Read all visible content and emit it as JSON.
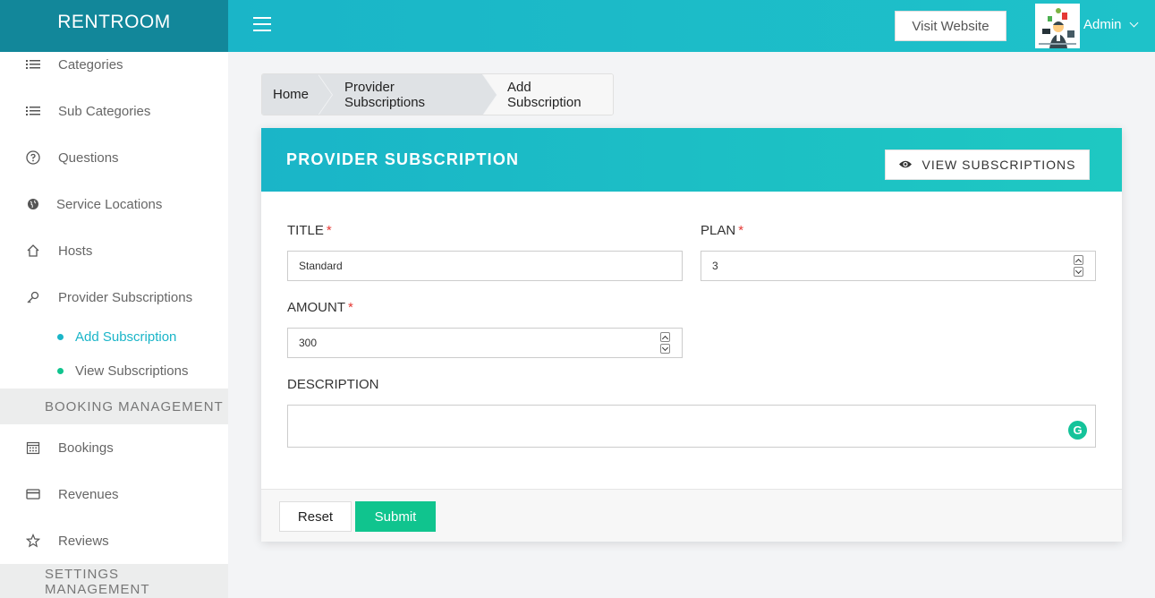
{
  "brand": "RENTROOM",
  "topbar": {
    "visit_website": "Visit Website",
    "user_name": "Admin"
  },
  "sidebar": {
    "items": [
      {
        "label": "Categories",
        "icon": "list-icon"
      },
      {
        "label": "Sub Categories",
        "icon": "list-icon"
      },
      {
        "label": "Questions",
        "icon": "question-circle-icon"
      },
      {
        "label": "Service Locations",
        "icon": "globe-icon"
      },
      {
        "label": "Hosts",
        "icon": "home-icon"
      },
      {
        "label": "Provider Subscriptions",
        "icon": "key-icon"
      }
    ],
    "sub_items": [
      {
        "label": "Add Subscription",
        "active": true
      },
      {
        "label": "View Subscriptions",
        "active": false
      }
    ],
    "section_booking": "BOOKING MANAGEMENT",
    "booking_items": [
      {
        "label": "Bookings",
        "icon": "calendar-icon"
      },
      {
        "label": "Revenues",
        "icon": "credit-card-icon"
      },
      {
        "label": "Reviews",
        "icon": "star-icon"
      }
    ],
    "section_settings": "SETTINGS MANAGEMENT"
  },
  "breadcrumb": [
    "Home",
    "Provider Subscriptions",
    "Add Subscription"
  ],
  "card": {
    "title": "PROVIDER SUBSCRIPTION",
    "view_button": "VIEW SUBSCRIPTIONS"
  },
  "form": {
    "title_label": "TITLE",
    "title_value": "Standard",
    "plan_label": "PLAN",
    "plan_value": "3",
    "amount_label": "AMOUNT",
    "amount_value": "300",
    "description_label": "DESCRIPTION",
    "description_value": "",
    "required_mark": "*",
    "grammarly_glyph": "G"
  },
  "footer": {
    "reset": "Reset",
    "submit": "Submit"
  },
  "colors": {
    "accent": "#1ab5c8",
    "brand_dark": "#12879a",
    "submit": "#10c48e",
    "required": "#e53935"
  }
}
